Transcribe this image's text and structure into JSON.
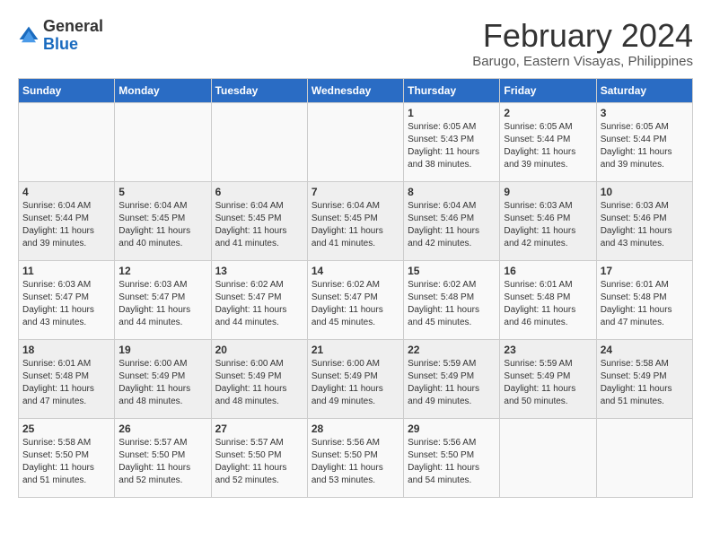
{
  "header": {
    "logo_general": "General",
    "logo_blue": "Blue",
    "month_title": "February 2024",
    "location": "Barugo, Eastern Visayas, Philippines"
  },
  "weekdays": [
    "Sunday",
    "Monday",
    "Tuesday",
    "Wednesday",
    "Thursday",
    "Friday",
    "Saturday"
  ],
  "weeks": [
    [
      {
        "day": "",
        "info": ""
      },
      {
        "day": "",
        "info": ""
      },
      {
        "day": "",
        "info": ""
      },
      {
        "day": "",
        "info": ""
      },
      {
        "day": "1",
        "info": "Sunrise: 6:05 AM\nSunset: 5:43 PM\nDaylight: 11 hours and 38 minutes."
      },
      {
        "day": "2",
        "info": "Sunrise: 6:05 AM\nSunset: 5:44 PM\nDaylight: 11 hours and 39 minutes."
      },
      {
        "day": "3",
        "info": "Sunrise: 6:05 AM\nSunset: 5:44 PM\nDaylight: 11 hours and 39 minutes."
      }
    ],
    [
      {
        "day": "4",
        "info": "Sunrise: 6:04 AM\nSunset: 5:44 PM\nDaylight: 11 hours and 39 minutes."
      },
      {
        "day": "5",
        "info": "Sunrise: 6:04 AM\nSunset: 5:45 PM\nDaylight: 11 hours and 40 minutes."
      },
      {
        "day": "6",
        "info": "Sunrise: 6:04 AM\nSunset: 5:45 PM\nDaylight: 11 hours and 41 minutes."
      },
      {
        "day": "7",
        "info": "Sunrise: 6:04 AM\nSunset: 5:45 PM\nDaylight: 11 hours and 41 minutes."
      },
      {
        "day": "8",
        "info": "Sunrise: 6:04 AM\nSunset: 5:46 PM\nDaylight: 11 hours and 42 minutes."
      },
      {
        "day": "9",
        "info": "Sunrise: 6:03 AM\nSunset: 5:46 PM\nDaylight: 11 hours and 42 minutes."
      },
      {
        "day": "10",
        "info": "Sunrise: 6:03 AM\nSunset: 5:46 PM\nDaylight: 11 hours and 43 minutes."
      }
    ],
    [
      {
        "day": "11",
        "info": "Sunrise: 6:03 AM\nSunset: 5:47 PM\nDaylight: 11 hours and 43 minutes."
      },
      {
        "day": "12",
        "info": "Sunrise: 6:03 AM\nSunset: 5:47 PM\nDaylight: 11 hours and 44 minutes."
      },
      {
        "day": "13",
        "info": "Sunrise: 6:02 AM\nSunset: 5:47 PM\nDaylight: 11 hours and 44 minutes."
      },
      {
        "day": "14",
        "info": "Sunrise: 6:02 AM\nSunset: 5:47 PM\nDaylight: 11 hours and 45 minutes."
      },
      {
        "day": "15",
        "info": "Sunrise: 6:02 AM\nSunset: 5:48 PM\nDaylight: 11 hours and 45 minutes."
      },
      {
        "day": "16",
        "info": "Sunrise: 6:01 AM\nSunset: 5:48 PM\nDaylight: 11 hours and 46 minutes."
      },
      {
        "day": "17",
        "info": "Sunrise: 6:01 AM\nSunset: 5:48 PM\nDaylight: 11 hours and 47 minutes."
      }
    ],
    [
      {
        "day": "18",
        "info": "Sunrise: 6:01 AM\nSunset: 5:48 PM\nDaylight: 11 hours and 47 minutes."
      },
      {
        "day": "19",
        "info": "Sunrise: 6:00 AM\nSunset: 5:49 PM\nDaylight: 11 hours and 48 minutes."
      },
      {
        "day": "20",
        "info": "Sunrise: 6:00 AM\nSunset: 5:49 PM\nDaylight: 11 hours and 48 minutes."
      },
      {
        "day": "21",
        "info": "Sunrise: 6:00 AM\nSunset: 5:49 PM\nDaylight: 11 hours and 49 minutes."
      },
      {
        "day": "22",
        "info": "Sunrise: 5:59 AM\nSunset: 5:49 PM\nDaylight: 11 hours and 49 minutes."
      },
      {
        "day": "23",
        "info": "Sunrise: 5:59 AM\nSunset: 5:49 PM\nDaylight: 11 hours and 50 minutes."
      },
      {
        "day": "24",
        "info": "Sunrise: 5:58 AM\nSunset: 5:49 PM\nDaylight: 11 hours and 51 minutes."
      }
    ],
    [
      {
        "day": "25",
        "info": "Sunrise: 5:58 AM\nSunset: 5:50 PM\nDaylight: 11 hours and 51 minutes."
      },
      {
        "day": "26",
        "info": "Sunrise: 5:57 AM\nSunset: 5:50 PM\nDaylight: 11 hours and 52 minutes."
      },
      {
        "day": "27",
        "info": "Sunrise: 5:57 AM\nSunset: 5:50 PM\nDaylight: 11 hours and 52 minutes."
      },
      {
        "day": "28",
        "info": "Sunrise: 5:56 AM\nSunset: 5:50 PM\nDaylight: 11 hours and 53 minutes."
      },
      {
        "day": "29",
        "info": "Sunrise: 5:56 AM\nSunset: 5:50 PM\nDaylight: 11 hours and 54 minutes."
      },
      {
        "day": "",
        "info": ""
      },
      {
        "day": "",
        "info": ""
      }
    ]
  ]
}
